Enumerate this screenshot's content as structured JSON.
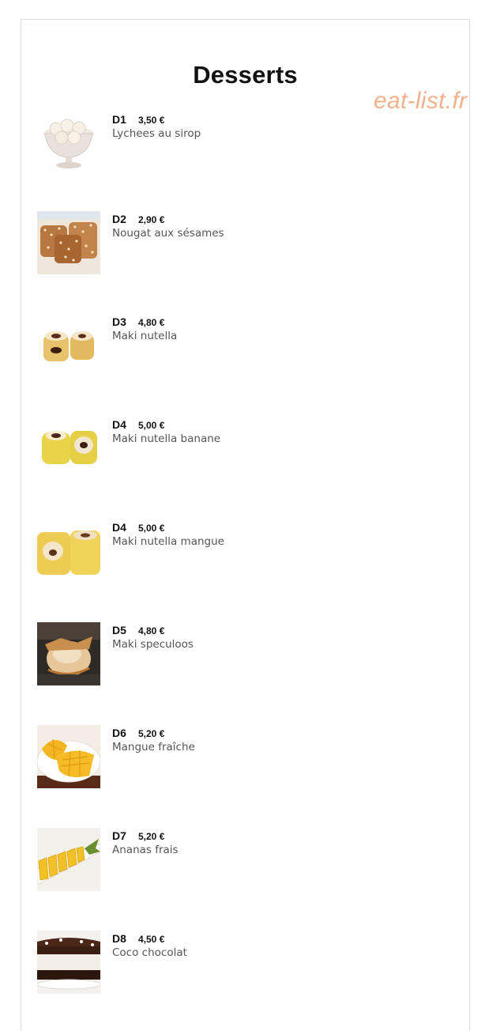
{
  "page": {
    "title": "Desserts",
    "watermark": "eat-list.fr"
  },
  "items": [
    {
      "code": "D1",
      "price": "3,50 €",
      "name": "Lychees au sirop",
      "image": "lychee-bowl-photo"
    },
    {
      "code": "D2",
      "price": "2,90 €",
      "name": "Nougat aux sésames",
      "image": "sesame-nougat-photo"
    },
    {
      "code": "D3",
      "price": "4,80 €",
      "name": "Maki nutella",
      "image": "maki-nutella-photo"
    },
    {
      "code": "D4",
      "price": "5,00 €",
      "name": "Maki nutella banane",
      "image": "maki-nutella-banana-photo"
    },
    {
      "code": "D4",
      "price": "5,00 €",
      "name": "Maki nutella mangue",
      "image": "maki-nutella-mango-photo"
    },
    {
      "code": "D5",
      "price": "4,80 €",
      "name": "Maki speculoos",
      "image": "maki-speculoos-photo"
    },
    {
      "code": "D6",
      "price": "5,20 €",
      "name": "Mangue fraîche",
      "image": "fresh-mango-photo"
    },
    {
      "code": "D7",
      "price": "5,20 €",
      "name": "Ananas frais",
      "image": "fresh-pineapple-photo"
    },
    {
      "code": "D8",
      "price": "4,50 €",
      "name": "Coco chocolat",
      "image": "coco-chocolate-cake-photo"
    }
  ],
  "colors": {
    "watermark": "#f2b18c",
    "text": "#111111",
    "description": "#555555",
    "border": "#dcdcdc"
  }
}
